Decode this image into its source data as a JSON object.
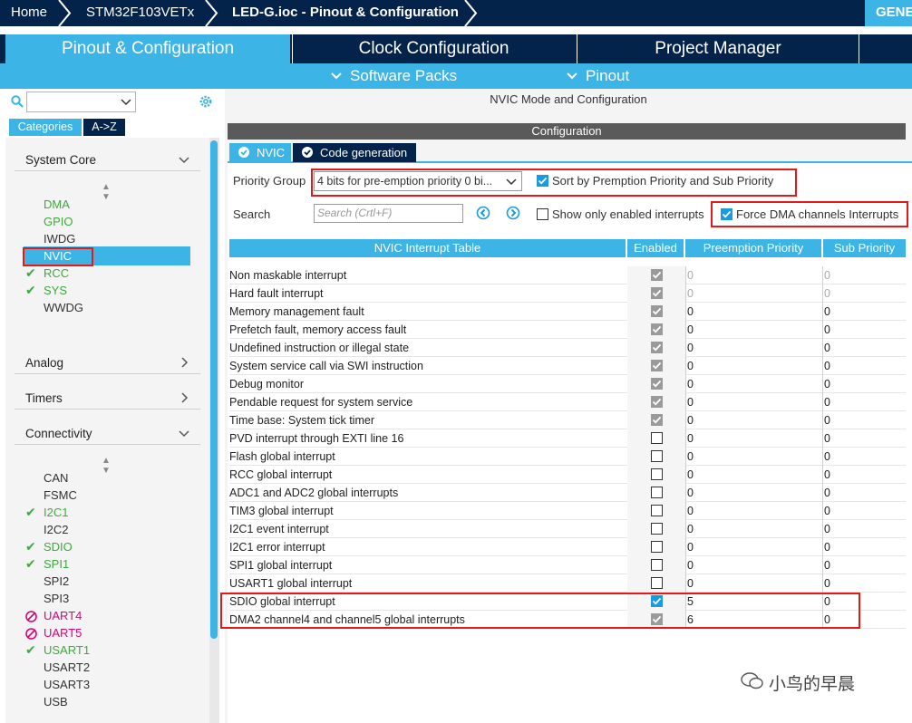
{
  "breadcrumb": {
    "home": "Home",
    "chip": "STM32F103VETx",
    "file": "LED-G.ioc - Pinout & Configuration",
    "generate": "GENERATE CODE"
  },
  "main_tabs": [
    "Pinout & Configuration",
    "Clock Configuration",
    "Project Manager"
  ],
  "sub_menu": [
    "Software Packs",
    "Pinout"
  ],
  "left": {
    "category_tab": "Categories",
    "az_tab": "A->Z",
    "system_core": {
      "title": "System Core",
      "items": [
        {
          "label": "DMA",
          "status": "green"
        },
        {
          "label": "GPIO",
          "status": "green"
        },
        {
          "label": "IWDG",
          "status": "none"
        },
        {
          "label": "NVIC",
          "status": "selected"
        },
        {
          "label": "RCC",
          "status": "check"
        },
        {
          "label": "SYS",
          "status": "check"
        },
        {
          "label": "WWDG",
          "status": "none"
        }
      ]
    },
    "analog": "Analog",
    "timers": "Timers",
    "connectivity": {
      "title": "Connectivity",
      "items": [
        {
          "label": "CAN",
          "status": "none"
        },
        {
          "label": "FSMC",
          "status": "none"
        },
        {
          "label": "I2C1",
          "status": "check"
        },
        {
          "label": "I2C2",
          "status": "none"
        },
        {
          "label": "SDIO",
          "status": "check"
        },
        {
          "label": "SPI1",
          "status": "check"
        },
        {
          "label": "SPI2",
          "status": "none"
        },
        {
          "label": "SPI3",
          "status": "none"
        },
        {
          "label": "UART4",
          "status": "conflict"
        },
        {
          "label": "UART5",
          "status": "conflict"
        },
        {
          "label": "USART1",
          "status": "check"
        },
        {
          "label": "USART2",
          "status": "none"
        },
        {
          "label": "USART3",
          "status": "none"
        },
        {
          "label": "USB",
          "status": "none"
        }
      ]
    }
  },
  "panel": {
    "mode_title": "NVIC Mode and Configuration",
    "configuration": "Configuration",
    "tab_nvic": "NVIC",
    "tab_codegen": "Code generation",
    "priority_group_label": "Priority Group",
    "priority_group_value": "4 bits for pre-emption priority 0 bi...",
    "sort_label": "Sort by Premption Priority and Sub Priority",
    "search_label": "Search",
    "search_placeholder": "Search (Crtl+F)",
    "show_enabled_label": "Show only enabled interrupts",
    "force_dma_label": "Force DMA channels Interrupts",
    "sort_checked": true,
    "show_enabled_checked": false,
    "force_dma_checked": true
  },
  "table": {
    "headers": [
      "NVIC Interrupt Table",
      "Enabled",
      "Preemption Priority",
      "Sub Priority"
    ],
    "rows": [
      {
        "name": "Non maskable interrupt",
        "enabled": "locked",
        "pre": "0",
        "sub": "0",
        "pre_gray": true,
        "sub_gray": true
      },
      {
        "name": "Hard fault interrupt",
        "enabled": "locked",
        "pre": "0",
        "sub": "0",
        "pre_gray": true,
        "sub_gray": true
      },
      {
        "name": "Memory management fault",
        "enabled": "locked",
        "pre": "0",
        "sub": "0"
      },
      {
        "name": "Prefetch fault, memory access fault",
        "enabled": "locked",
        "pre": "0",
        "sub": "0"
      },
      {
        "name": "Undefined instruction or illegal state",
        "enabled": "locked",
        "pre": "0",
        "sub": "0"
      },
      {
        "name": "System service call via SWI instruction",
        "enabled": "locked",
        "pre": "0",
        "sub": "0"
      },
      {
        "name": "Debug monitor",
        "enabled": "locked",
        "pre": "0",
        "sub": "0"
      },
      {
        "name": "Pendable request for system service",
        "enabled": "locked",
        "pre": "0",
        "sub": "0"
      },
      {
        "name": "Time base: System tick timer",
        "enabled": "locked",
        "pre": "0",
        "sub": "0"
      },
      {
        "name": "PVD interrupt through EXTI line 16",
        "enabled": "off",
        "pre": "0",
        "sub": "0"
      },
      {
        "name": "Flash global interrupt",
        "enabled": "off",
        "pre": "0",
        "sub": "0"
      },
      {
        "name": "RCC global interrupt",
        "enabled": "off",
        "pre": "0",
        "sub": "0"
      },
      {
        "name": "ADC1 and ADC2 global interrupts",
        "enabled": "off",
        "pre": "0",
        "sub": "0"
      },
      {
        "name": "TIM3 global interrupt",
        "enabled": "off",
        "pre": "0",
        "sub": "0"
      },
      {
        "name": "I2C1 event interrupt",
        "enabled": "off",
        "pre": "0",
        "sub": "0"
      },
      {
        "name": "I2C1 error interrupt",
        "enabled": "off",
        "pre": "0",
        "sub": "0"
      },
      {
        "name": "SPI1 global interrupt",
        "enabled": "off",
        "pre": "0",
        "sub": "0"
      },
      {
        "name": "USART1 global interrupt",
        "enabled": "off",
        "pre": "0",
        "sub": "0"
      },
      {
        "name": "SDIO global interrupt",
        "enabled": "on",
        "pre": "5",
        "sub": "0"
      },
      {
        "name": "DMA2 channel4 and channel5 global interrupts",
        "enabled": "locked",
        "pre": "6",
        "sub": "0"
      }
    ]
  },
  "watermark": "小鸟的早晨",
  "colors": {
    "navy": "#03234b",
    "accent": "#3cb4e6",
    "green": "#3daa3d",
    "conflict": "#e0007a",
    "highlight": "#e21a1a"
  }
}
